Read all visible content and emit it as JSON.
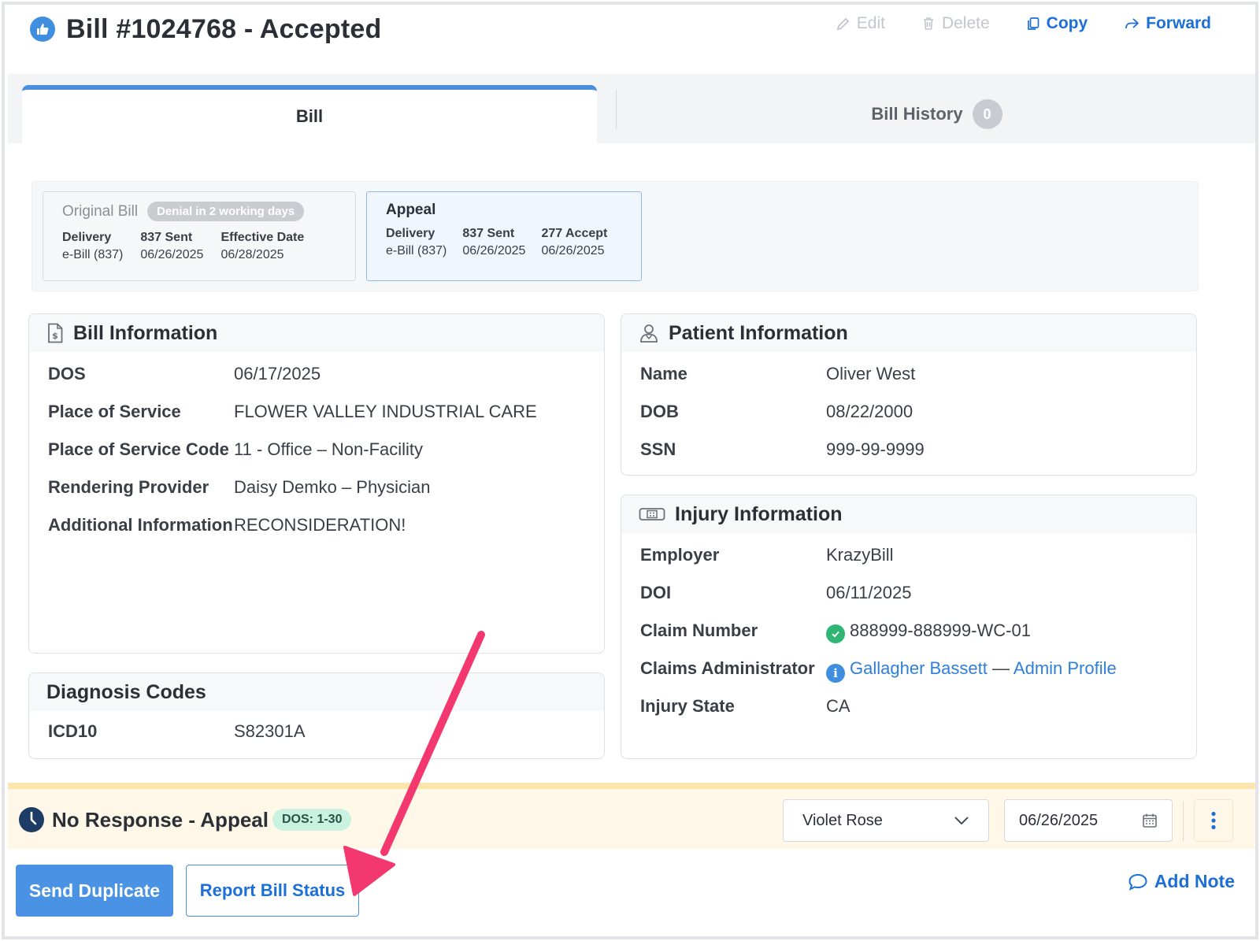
{
  "header": {
    "title": "Bill #1024768 - Accepted",
    "actions": {
      "edit": "Edit",
      "delete": "Delete",
      "copy": "Copy",
      "forward": "Forward"
    }
  },
  "tabs": {
    "bill": "Bill",
    "history": "Bill History",
    "history_count": "0"
  },
  "bill_cards": {
    "original": {
      "title": "Original Bill",
      "badge": "Denial in 2 working days",
      "cols": [
        {
          "label": "Delivery",
          "value": "e-Bill (837)"
        },
        {
          "label": "837 Sent",
          "value": "06/26/2025"
        },
        {
          "label": "Effective Date",
          "value": "06/28/2025"
        }
      ]
    },
    "appeal": {
      "title": "Appeal",
      "cols": [
        {
          "label": "Delivery",
          "value": "e-Bill (837)"
        },
        {
          "label": "837 Sent",
          "value": "06/26/2025"
        },
        {
          "label": "277 Accept",
          "value": "06/26/2025"
        }
      ]
    }
  },
  "bill_info": {
    "title": "Bill Information",
    "rows": [
      {
        "k": "DOS",
        "v": "06/17/2025"
      },
      {
        "k": "Place of Service",
        "v": "FLOWER VALLEY INDUSTRIAL CARE"
      },
      {
        "k": "Place of Service Code",
        "v": "11 - Office – Non-Facility"
      },
      {
        "k": "Rendering Provider",
        "v": "Daisy Demko – Physician"
      },
      {
        "k": "Additional Information",
        "v": "RECONSIDERATION!"
      }
    ]
  },
  "diagnosis": {
    "title": "Diagnosis Codes",
    "rows": [
      {
        "k": "ICD10",
        "v": "S82301A"
      }
    ]
  },
  "patient": {
    "title": "Patient Information",
    "rows": [
      {
        "k": "Name",
        "v": "Oliver West"
      },
      {
        "k": "DOB",
        "v": "08/22/2000"
      },
      {
        "k": "SSN",
        "v": "999-99-9999"
      }
    ]
  },
  "injury": {
    "title": "Injury Information",
    "employer_label": "Employer",
    "employer": "KrazyBill",
    "doi_label": "DOI",
    "doi": "06/11/2025",
    "claim_label": "Claim Number",
    "claim": "888999-888999-WC-01",
    "admin_label": "Claims Administrator",
    "admin_name": "Gallagher Bassett",
    "admin_sep": "—",
    "admin_profile": "Admin Profile",
    "state_label": "Injury State",
    "state": "CA"
  },
  "status_bar": {
    "title": "No Response - Appeal",
    "dos_badge": "DOS: 1-30",
    "assignee": "Violet Rose",
    "date": "06/26/2025"
  },
  "buttons": {
    "send_duplicate": "Send Duplicate",
    "report_status": "Report Bill Status",
    "add_note": "Add Note"
  },
  "colors": {
    "accent": "#1c6fd6",
    "arrow": "#f2386f",
    "status_bg": "#fff8e9",
    "check": "#2fb673"
  }
}
